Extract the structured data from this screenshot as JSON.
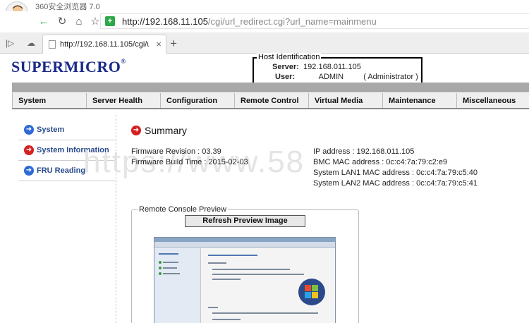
{
  "browser": {
    "app_title": "360安全浏览器 7.0",
    "url_host": "http://192.168.11.105",
    "url_path": "/cgi/url_redirect.cgi?url_name=mainmenu",
    "tab_title": "http://192.168.11.105/cgi/u"
  },
  "page": {
    "logo_text": "SUPERMICRO",
    "host": {
      "legend": "Host Identification",
      "server_label": "Server:",
      "server_value": "192.168.011.105",
      "user_label": "User:",
      "user_value": "ADMIN",
      "user_role": "( Administrator )"
    },
    "menu": [
      "System",
      "Server Health",
      "Configuration",
      "Remote Control",
      "Virtual Media",
      "Maintenance",
      "Miscellaneous"
    ],
    "sidebar": [
      {
        "label": "System",
        "icon": "arrow-right-blue-icon",
        "color": "#2f6bd6"
      },
      {
        "label": "System Information",
        "icon": "arrow-right-red-icon",
        "color": "#d42020"
      },
      {
        "label": "FRU Reading",
        "icon": "arrow-right-blue-icon",
        "color": "#2f6bd6"
      }
    ],
    "summary": {
      "title": "Summary",
      "firmware_revision": "Firmware Revision : 03.39",
      "firmware_build": "Firmware Build Time : 2015-02-03",
      "ip": "IP address : 192.168.011.105",
      "bmc_mac": "BMC MAC address : 0c:c4:7a:79:c2:e9",
      "lan1_mac": "System LAN1 MAC address : 0c:c4:7a:79:c5:40",
      "lan2_mac": "System LAN2 MAC address : 0c:c4:7a:79:c5:41"
    },
    "watermark": "https://www.58",
    "preview": {
      "legend": "Remote Console Preview",
      "refresh_label": "Refresh Preview Image"
    }
  },
  "colors": {
    "brand": "#1a2a8a",
    "active_red": "#d42020",
    "link_blue": "#2a4c8c"
  }
}
